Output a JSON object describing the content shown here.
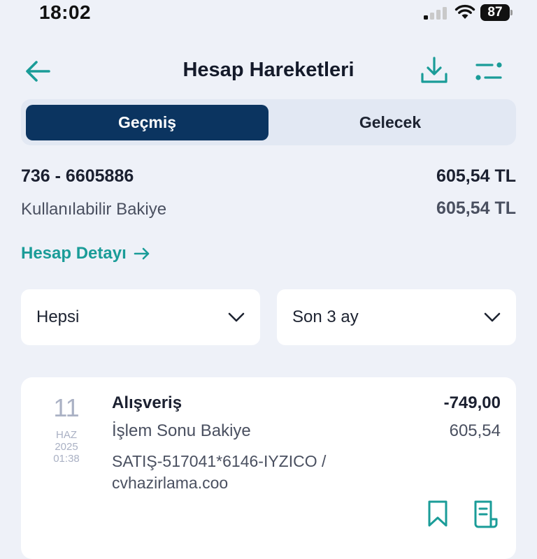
{
  "status_bar": {
    "time": "18:02",
    "battery": "87"
  },
  "header": {
    "title": "Hesap Hareketleri"
  },
  "tabs": {
    "past": "Geçmiş",
    "future": "Gelecek"
  },
  "account": {
    "number": "736 - 6605886",
    "balance": "605,54 TL",
    "available_label": "Kullanılabilir Bakiye",
    "available_value": "605,54 TL",
    "detail_link": "Hesap Detayı"
  },
  "filters": {
    "type": "Hepsi",
    "period": "Son 3 ay"
  },
  "transaction": {
    "day": "11",
    "month": "HAZ",
    "year": "2025",
    "time": "01:38",
    "title": "Alışveriş",
    "amount": "-749,00",
    "balance_label": "İşlem Sonu Bakiye",
    "balance_value": "605,54",
    "description_line1": "SATIŞ-517041*6146-IYZICO /",
    "description_line2": "cvhazirlama.coo"
  },
  "colors": {
    "accent": "#1a9c98",
    "primary": "#0b3460",
    "background": "#eef1f8"
  },
  "icons": [
    "back-arrow-icon",
    "download-icon",
    "filter-icon",
    "arrow-right-icon",
    "chevron-down-icon",
    "bookmark-icon",
    "receipt-icon"
  ]
}
